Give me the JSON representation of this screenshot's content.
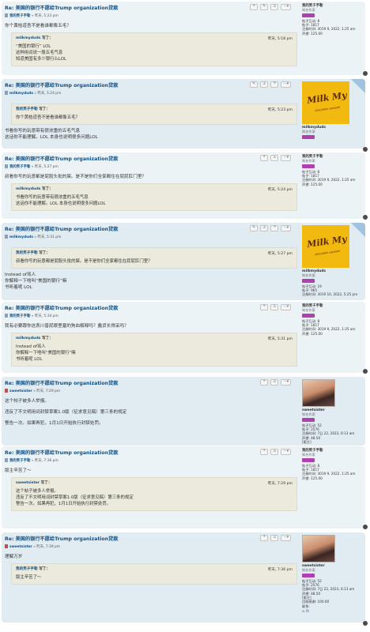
{
  "posts": [
    {
      "title": "Re: 美国的银行不愿给Trump organization贷款",
      "author": "我的笑子手勒",
      "date": "» 昨天, 5:23 pm",
      "content_before": [
        "你个黄桔道吾不是看谁都像五毛？"
      ],
      "quote": {
        "author": "milkmyduds",
        "said": "写了：",
        "date": "昨天, 5:18 pm",
        "lines": [
          "“美国的银行”  LOL",
          "这种用词说一股五毛气息",
          "",
          "知道美国有多少银行么LOL"
        ]
      },
      "profile": {
        "name": "我的笑子手勒",
        "rank": "知名作家",
        "lines": [
          "帖子互动: 8",
          "帖子: 1817",
          "注册时间: 3019 9, 2022, 1:25 am",
          "声望: 125.00"
        ]
      },
      "buttons": [
        "❝",
        "✎",
        "⚠",
        "···▾"
      ]
    },
    {
      "title": "Re: 美国的银行不愿给Trump organization贷款",
      "author": "milkmyduds",
      "date": "» 昨天, 5:24 pm",
      "quote": {
        "author": "我的笑子手勒",
        "said": "写了：",
        "date": "昨天, 5:23 pm",
        "lines": [
          "你个黄桔道吾不是看谁都像五毛？"
        ]
      },
      "content_after": [
        "书看你写的玩意带有很浓重的五毛气息",
        "这话你不能理解。LOL   本身也说明很多问题LOL"
      ],
      "profile": {
        "name": "milkmyduds",
        "rank": "知名作家",
        "lines": []
      },
      "avatar_text": "Milk My Duds",
      "avatar_sub": "chocolate caramel",
      "buttons": [
        "✎",
        "⚠",
        "❝",
        "···▾"
      ]
    },
    {
      "title": "Re: 美国的银行不愿给Trump organization贷款",
      "author": "我的笑子手勒",
      "date": "» 昨天, 5:27 pm",
      "content_before": [
        "叔看你写的玩意都是屁股头批的屎。是不是你们全家都住在屁屁肛门里？"
      ],
      "quote": {
        "author": "milkmyduds",
        "said": "写了：",
        "date": "昨天, 5:24 pm",
        "lines": [
          "书看你写的玩意带有很浓重的五毛气息",
          "这话你不能理解。LOL   本身也说明很多问题LOL"
        ]
      },
      "profile": {
        "name": "我的笑子手勒",
        "rank": "知名作家",
        "lines": [
          "帖子互动: 8",
          "帖子: 1817",
          "注册时间: 3019 9, 2022, 1:25 am",
          "声望: 125.00"
        ]
      },
      "buttons": [
        "❝",
        "⚠",
        "···▾"
      ]
    },
    {
      "title": "Re: 美国的银行不愿给Trump organization贷款",
      "author": "milkmyduds",
      "date": "» 昨天, 5:31 pm",
      "quote": {
        "author": "我的笑子手勒",
        "said": "写了：",
        "date": "昨天, 5:27 pm",
        "lines": [
          "叔看你写的玩意都是屁股头批的屎。是不是你们全家都住在屁屁肛门里？"
        ]
      },
      "content_after": [
        "Instead of骂人",
        "你解释一下啥叫“美国的银行”嘛",
        "书听着呢   LOL"
      ],
      "profile": {
        "name": "milkmyduds",
        "rank": "知名作家",
        "lines": [
          "帖子互动: 19",
          "帖子: 965",
          "注册时间: 3019 10, 2022, 5:25 pm"
        ]
      },
      "avatar_text": "Milk My Duds",
      "avatar_sub": "chocolate caramel",
      "buttons": [
        "✎",
        "⚠",
        "❝",
        "···▾"
      ]
    },
    {
      "title": "Re: 美国的银行不愿给Trump organization贷款",
      "author": "我的笑子手勒",
      "date": "» 昨天, 5:34 pm",
      "content_before": [
        "我有必要跟你这表川普屁眼里塞的狗血解释吗？蠢货长得采吗？"
      ],
      "quote": {
        "author": "milkmyduds",
        "said": "写了：",
        "date": "昨天, 5:31 pm",
        "lines": [
          "Instead of骂人",
          "你解释一下啥叫“美国的银行”嘛",
          "书听着呢   LOL"
        ]
      },
      "profile": {
        "name": "我的笑子手勒",
        "rank": "知名作家",
        "lines": [
          "帖子互动: 8",
          "帖子: 1817",
          "注册时间: 3019 9, 2022, 1:25 am",
          "声望: 125.00"
        ]
      },
      "buttons": [
        "❝",
        "⚠",
        "···▾"
      ]
    },
    {
      "title": "Re: 美国的银行不愿给Trump organization贷款",
      "author": "sweetsister",
      "date": "» 昨天, 7:29 pm",
      "content_before": [
        "这个帖子被多人举报。",
        "",
        "违反了不文明用词封禁草案1.0版（征求意见稿）第三条的规定",
        "",
        "警告一次。如果再犯，1月1日开始执行封禁处罚。"
      ],
      "profile": {
        "name": "sweetsister",
        "rank": "知名作家",
        "lines": [
          "帖子互动: 52",
          "帖子: 2576",
          "注册时间: 7日 22, 2023, 6:13 am",
          "声望: 48.50",
          "[版主]"
        ]
      },
      "buttons": [
        "❝",
        "⚠",
        "···▾"
      ]
    },
    {
      "title": "Re: 美国的银行不愿给Trump organization贷款",
      "author": "我的笑子手勒",
      "date": "» 昨天, 7:36 pm",
      "content_before": [
        "版主辛苦了～"
      ],
      "quote": {
        "author": "sweetsister",
        "said": "写了：",
        "date": "昨天, 7:29 pm",
        "lines": [
          "这个帖子被多人举报。",
          "",
          "违反了不文明用词封禁草案1.0版（征求意见稿）第三条的规定",
          "",
          "警告一次。如果再犯，1月1日开始执行封禁处罚。"
        ]
      },
      "profile": {
        "name": "我的笑子手勒",
        "rank": "知名作家",
        "lines": [
          "帖子互动: 8",
          "帖子: 1817",
          "注册时间: 3019 9, 2022, 1:25 am",
          "声望: 125.00"
        ]
      },
      "buttons": [
        "❝",
        "⚠",
        "···▾"
      ]
    },
    {
      "title": "Re: 美国的银行不愿给Trump organization贷款",
      "author": "sweetsister",
      "date": "» 昨天, 7:39 pm",
      "content_before": [
        "理解万岁"
      ],
      "quote": {
        "author": "我的笑子手勒",
        "said": "写了：",
        "date": "昨天, 7:36 pm",
        "lines": [
          "版主辛苦了～"
        ]
      },
      "profile": {
        "name": "sweetsister",
        "rank": "知名作家",
        "lines": [
          "帖子互动: 52",
          "帖子: 2576",
          "注册时间: 7日 22, 2023, 6:13 am",
          "声望: 48.50",
          "[版主]",
          "目前感谢: 100.00",
          "联系:"
        ]
      },
      "buttons": [
        "❝",
        "⚠",
        "···▾"
      ]
    }
  ]
}
